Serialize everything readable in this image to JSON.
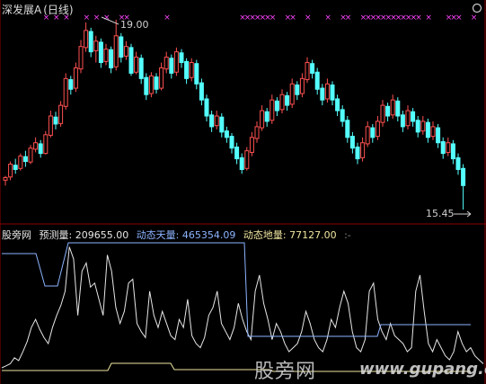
{
  "header": {
    "symbol": "深发展A",
    "period": "(日线)"
  },
  "indicator": {
    "source": "股旁网",
    "items": [
      {
        "label": "预测量: 209655.00",
        "color": "#e6e6e6"
      },
      {
        "label": "动态天量: 465354.09",
        "color": "#8cb4ff"
      },
      {
        "label": "动态地量: 77127.00",
        "color": "#f0e6a0"
      }
    ],
    "tail": ":-"
  },
  "watermark": {
    "text": "股旁网",
    "url": "www.gupang.com"
  },
  "colors": {
    "up": "#ff5050",
    "down": "#54ffff",
    "marker": "#ff44ff",
    "divider": "#8b0000",
    "volume_line": "#e6e6e6",
    "sky_line": "#8cb4ff",
    "ground_line": "#f0e6a0"
  },
  "chart_data": [
    {
      "type": "candlestick",
      "title": "深发展A (日线)",
      "annotations": [
        {
          "label": "19.00",
          "value": 19.0
        },
        {
          "label": "15.45",
          "value": 15.45
        }
      ],
      "ylim": [
        15.3,
        19.1
      ],
      "candles": [
        [
          16.0,
          16.05,
          15.9,
          16.08
        ],
        [
          16.06,
          16.3,
          16.0,
          16.35
        ],
        [
          16.28,
          16.2,
          16.12,
          16.4
        ],
        [
          16.22,
          16.45,
          16.18,
          16.5
        ],
        [
          16.44,
          16.35,
          16.25,
          16.55
        ],
        [
          16.34,
          16.6,
          16.3,
          16.66
        ],
        [
          16.58,
          16.7,
          16.52,
          16.8
        ],
        [
          16.68,
          16.5,
          16.42,
          16.75
        ],
        [
          16.5,
          16.85,
          16.48,
          16.92
        ],
        [
          16.84,
          17.2,
          16.8,
          17.3
        ],
        [
          17.18,
          17.05,
          16.95,
          17.28
        ],
        [
          17.06,
          17.4,
          17.0,
          17.48
        ],
        [
          17.38,
          17.9,
          17.32,
          18.0
        ],
        [
          17.88,
          17.7,
          17.6,
          17.95
        ],
        [
          17.72,
          18.1,
          17.65,
          18.2
        ],
        [
          18.08,
          18.5,
          18.0,
          18.62
        ],
        [
          18.48,
          18.8,
          18.4,
          18.95
        ],
        [
          18.78,
          18.4,
          18.3,
          18.85
        ],
        [
          18.42,
          18.6,
          18.2,
          18.7
        ],
        [
          18.58,
          18.2,
          18.1,
          18.65
        ],
        [
          18.22,
          18.45,
          18.15,
          18.55
        ],
        [
          18.44,
          18.1,
          18.0,
          18.5
        ],
        [
          18.12,
          18.7,
          18.05,
          19.0
        ],
        [
          18.68,
          18.3,
          18.2,
          18.75
        ],
        [
          18.32,
          18.5,
          18.25,
          18.6
        ],
        [
          18.48,
          18.0,
          17.95,
          18.55
        ],
        [
          18.02,
          18.3,
          17.98,
          18.4
        ],
        [
          18.28,
          17.9,
          17.8,
          18.35
        ],
        [
          17.92,
          17.6,
          17.5,
          18.0
        ],
        [
          17.62,
          17.95,
          17.55,
          18.02
        ],
        [
          17.93,
          17.7,
          17.62,
          18.0
        ],
        [
          17.72,
          18.1,
          17.68,
          18.2
        ],
        [
          18.08,
          18.3,
          18.0,
          18.4
        ],
        [
          18.28,
          18.0,
          17.9,
          18.35
        ],
        [
          18.02,
          18.4,
          17.95,
          18.48
        ],
        [
          18.38,
          18.2,
          18.1,
          18.45
        ],
        [
          18.22,
          17.9,
          17.8,
          18.28
        ],
        [
          17.92,
          18.2,
          17.85,
          18.28
        ],
        [
          18.18,
          17.8,
          17.7,
          18.25
        ],
        [
          17.82,
          17.5,
          17.4,
          17.9
        ],
        [
          17.52,
          17.2,
          17.1,
          17.6
        ],
        [
          17.22,
          17.0,
          16.9,
          17.3
        ],
        [
          17.02,
          17.2,
          16.95,
          17.3
        ],
        [
          17.18,
          16.9,
          16.8,
          17.25
        ],
        [
          16.92,
          16.8,
          16.7,
          17.0
        ],
        [
          16.82,
          16.6,
          16.5,
          16.88
        ],
        [
          16.62,
          16.4,
          16.3,
          16.7
        ],
        [
          16.42,
          16.2,
          16.12,
          16.5
        ],
        [
          16.22,
          16.55,
          16.18,
          16.62
        ],
        [
          16.52,
          16.8,
          16.45,
          16.9
        ],
        [
          16.78,
          17.0,
          16.7,
          17.1
        ],
        [
          16.98,
          17.3,
          16.92,
          17.4
        ],
        [
          17.28,
          17.1,
          17.0,
          17.35
        ],
        [
          17.12,
          17.5,
          17.05,
          17.6
        ],
        [
          17.48,
          17.3,
          17.2,
          17.55
        ],
        [
          17.32,
          17.6,
          17.25,
          17.7
        ],
        [
          17.58,
          17.4,
          17.3,
          17.65
        ],
        [
          17.42,
          17.8,
          17.35,
          17.9
        ],
        [
          17.78,
          17.6,
          17.5,
          17.85
        ],
        [
          17.62,
          17.9,
          17.55,
          18.0
        ],
        [
          17.88,
          18.2,
          17.82,
          18.3
        ],
        [
          18.18,
          18.0,
          17.9,
          18.25
        ],
        [
          18.02,
          17.7,
          17.6,
          18.1
        ],
        [
          17.72,
          17.5,
          17.4,
          17.8
        ],
        [
          17.52,
          17.8,
          17.45,
          17.9
        ],
        [
          17.78,
          17.5,
          17.4,
          17.85
        ],
        [
          17.52,
          17.3,
          17.2,
          17.6
        ],
        [
          17.32,
          17.1,
          17.0,
          17.4
        ],
        [
          17.12,
          16.8,
          16.7,
          17.2
        ],
        [
          16.82,
          16.6,
          16.5,
          16.9
        ],
        [
          16.62,
          16.4,
          16.3,
          16.7
        ],
        [
          16.42,
          16.7,
          16.35,
          16.8
        ],
        [
          16.68,
          17.0,
          16.62,
          17.1
        ],
        [
          16.98,
          16.8,
          16.7,
          17.05
        ],
        [
          16.82,
          17.1,
          16.75,
          17.2
        ],
        [
          17.08,
          17.4,
          17.0,
          17.5
        ],
        [
          17.38,
          17.2,
          17.1,
          17.45
        ],
        [
          17.22,
          17.5,
          17.15,
          17.6
        ],
        [
          17.48,
          17.2,
          17.1,
          17.55
        ],
        [
          17.22,
          17.0,
          16.9,
          17.3
        ],
        [
          17.02,
          17.3,
          16.95,
          17.4
        ],
        [
          17.28,
          17.1,
          17.0,
          17.35
        ],
        [
          17.12,
          16.9,
          16.8,
          17.2
        ],
        [
          16.92,
          17.1,
          16.85,
          17.2
        ],
        [
          17.08,
          16.8,
          16.7,
          17.15
        ],
        [
          16.82,
          17.0,
          16.75,
          17.1
        ],
        [
          16.98,
          16.7,
          16.6,
          17.05
        ],
        [
          16.72,
          16.5,
          16.4,
          16.8
        ],
        [
          16.52,
          16.7,
          16.45,
          16.8
        ],
        [
          16.68,
          16.4,
          16.3,
          16.75
        ],
        [
          16.42,
          16.2,
          16.1,
          16.5
        ],
        [
          16.22,
          15.9,
          15.45,
          16.3
        ]
      ]
    },
    {
      "type": "line",
      "title": "预测量",
      "series": [
        {
          "name": "预测量",
          "values": [
            20,
            25,
            30,
            45,
            38,
            60,
            85,
            120,
            140,
            115,
            95,
            80,
            120,
            150,
            175,
            210,
            320,
            290,
            150,
            260,
            280,
            220,
            230,
            190,
            150,
            300,
            260,
            170,
            130,
            160,
            230,
            240,
            130,
            110,
            95,
            210,
            150,
            120,
            160,
            130,
            100,
            90,
            140,
            120,
            190,
            100,
            80,
            70,
            95,
            150,
            170,
            210,
            130,
            110,
            90,
            120,
            180,
            140,
            110,
            90,
            210,
            250,
            180,
            140,
            90,
            130,
            110,
            80,
            60,
            70,
            80,
            110,
            160,
            130,
            90,
            70,
            60,
            90,
            140,
            120,
            170,
            210,
            180,
            110,
            70,
            60,
            90,
            210,
            230,
            140,
            110,
            90,
            130,
            100,
            90,
            80,
            60,
            70,
            210,
            250,
            160,
            80,
            60,
            90,
            70,
            50,
            40,
            60,
            110,
            80,
            60,
            70,
            50,
            40,
            30
          ]
        },
        {
          "name": "动态天量",
          "values": [
            465354.09
          ]
        },
        {
          "name": "动态地量",
          "values": [
            77127.0
          ]
        }
      ]
    }
  ]
}
